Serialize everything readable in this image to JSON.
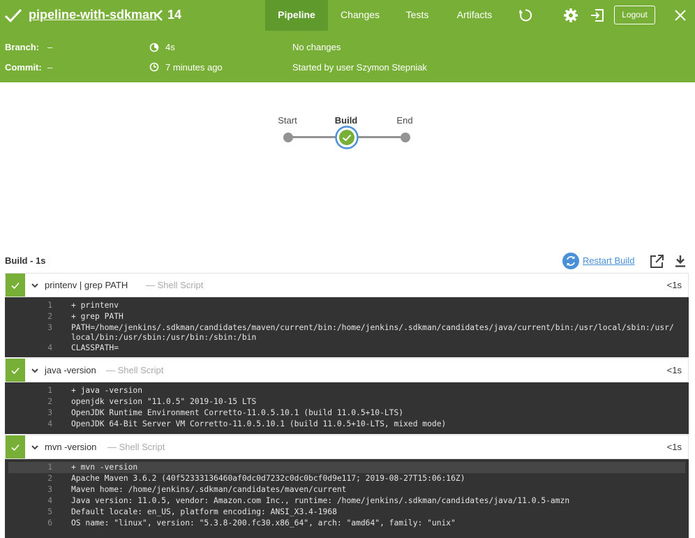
{
  "header": {
    "job_name": "pipeline-with-sdkman",
    "run_number": "14",
    "tabs": [
      "Pipeline",
      "Changes",
      "Tests",
      "Artifacts"
    ],
    "logout_label": "Logout"
  },
  "info": {
    "branch_label": "Branch:",
    "branch_value": "–",
    "commit_label": "Commit:",
    "commit_value": "–",
    "duration": "4s",
    "time_ago": "7 minutes ago",
    "changes": "No changes",
    "started_by": "Started by user Szymon Stepniak"
  },
  "graph": {
    "stages": [
      "Start",
      "Build",
      "End"
    ]
  },
  "log": {
    "title": "Build - 1s",
    "restart_label": "Restart Build",
    "steps": [
      {
        "name": "printenv | grep PATH",
        "type": "— Shell Script",
        "duration": "<1s",
        "lines": [
          "+ printenv",
          "+ grep PATH",
          "PATH=/home/jenkins/.sdkman/candidates/maven/current/bin:/home/jenkins/.sdkman/candidates/java/current/bin:/usr/local/sbin:/usr/local/bin:/usr/sbin:/usr/bin:/sbin:/bin",
          "CLASSPATH="
        ]
      },
      {
        "name": "java -version",
        "type": "— Shell Script",
        "duration": "<1s",
        "lines": [
          "+ java -version",
          "openjdk version \"11.0.5\" 2019-10-15 LTS",
          "OpenJDK Runtime Environment Corretto-11.0.5.10.1 (build 11.0.5+10-LTS)",
          "OpenJDK 64-Bit Server VM Corretto-11.0.5.10.1 (build 11.0.5+10-LTS, mixed mode)"
        ]
      },
      {
        "name": "mvn -version",
        "type": "— Shell Script",
        "duration": "<1s",
        "lines": [
          "+ mvn -version",
          "Apache Maven 3.6.2 (40f52333136460af0dc0d7232c0dc0bcf0d9e117; 2019-08-27T15:06:16Z)",
          "Maven home: /home/jenkins/.sdkman/candidates/maven/current",
          "Java version: 11.0.5, vendor: Amazon.com Inc., runtime: /home/jenkins/.sdkman/candidates/java/11.0.5-amzn",
          "Default locale: en_US, platform encoding: ANSI_X3.4-1968",
          "OS name: \"linux\", version: \"5.3.8-200.fc30.x86_64\", arch: \"amd64\", family: \"unix\""
        ]
      }
    ]
  }
}
